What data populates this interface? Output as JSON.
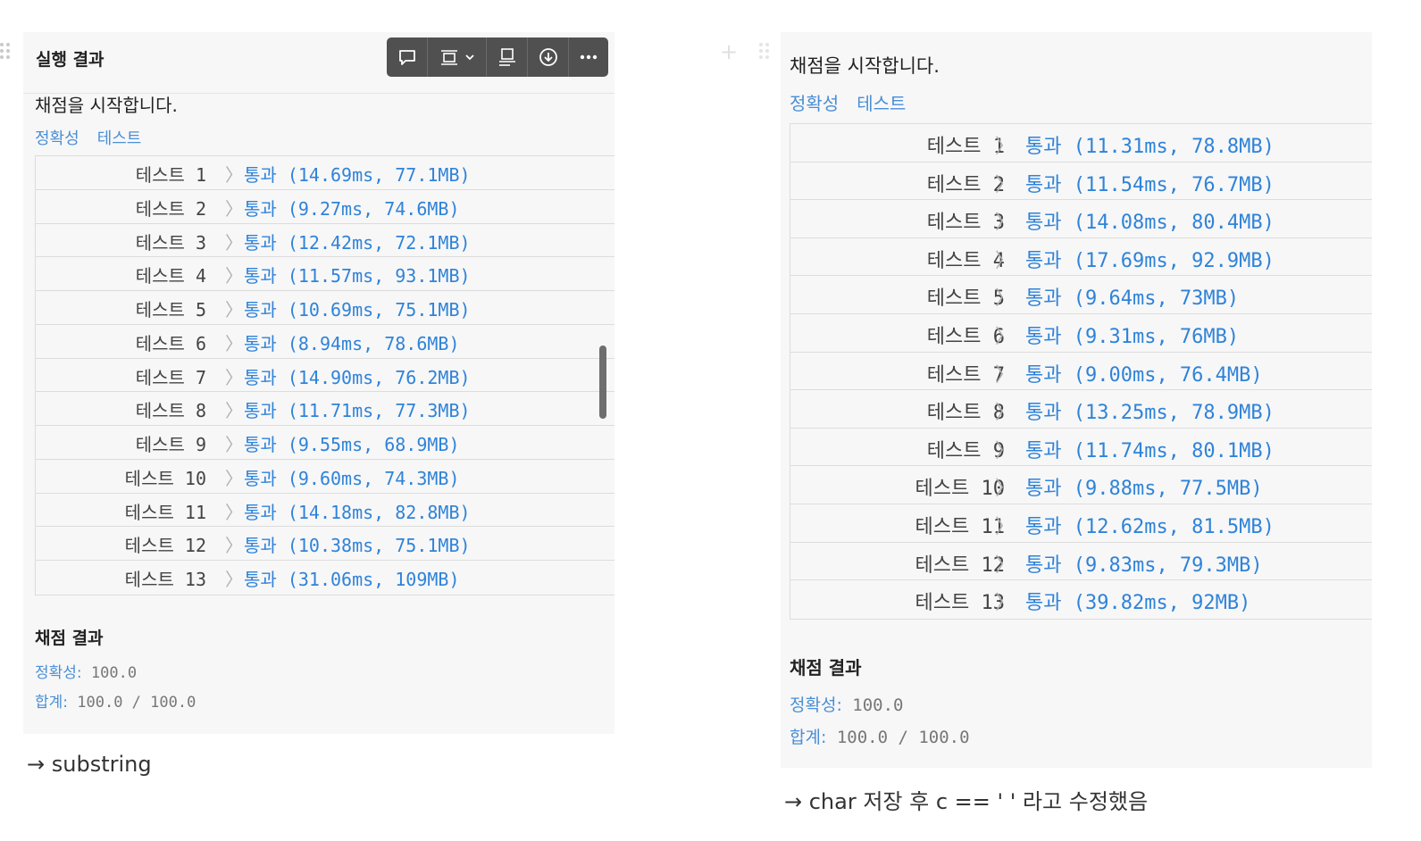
{
  "left": {
    "header_title": "실행 결과",
    "grading_start": "채점을 시작합니다.",
    "tab_accuracy": "정확성",
    "tab_test": "테스트",
    "chevron": "〉",
    "results": [
      {
        "label": "테스트 1",
        "result": "통과 (14.69ms, 77.1MB)"
      },
      {
        "label": "테스트 2",
        "result": "통과 (9.27ms, 74.6MB)"
      },
      {
        "label": "테스트 3",
        "result": "통과 (12.42ms, 72.1MB)"
      },
      {
        "label": "테스트 4",
        "result": "통과 (11.57ms, 93.1MB)"
      },
      {
        "label": "테스트 5",
        "result": "통과 (10.69ms, 75.1MB)"
      },
      {
        "label": "테스트 6",
        "result": "통과 (8.94ms, 78.6MB)"
      },
      {
        "label": "테스트 7",
        "result": "통과 (14.90ms, 76.2MB)"
      },
      {
        "label": "테스트 8",
        "result": "통과 (11.71ms, 77.3MB)"
      },
      {
        "label": "테스트 9",
        "result": "통과 (9.55ms, 68.9MB)"
      },
      {
        "label": "테스트 10",
        "result": "통과 (9.60ms, 74.3MB)"
      },
      {
        "label": "테스트 11",
        "result": "통과 (14.18ms, 82.8MB)"
      },
      {
        "label": "테스트 12",
        "result": "통과 (10.38ms, 75.1MB)"
      },
      {
        "label": "테스트 13",
        "result": "통과 (31.06ms, 109MB)"
      }
    ],
    "summary_title": "채점 결과",
    "accuracy_key": "정확성:",
    "accuracy_value": "100.0",
    "total_key": "합계:",
    "total_value": "100.0 / 100.0",
    "caption": "→ substring"
  },
  "right": {
    "grading_start": "채점을 시작합니다.",
    "tab_accuracy": "정확성",
    "tab_test": "테스트",
    "chevron": "〉",
    "results": [
      {
        "label": "테스트 1",
        "result": "통과 (11.31ms, 78.8MB)"
      },
      {
        "label": "테스트 2",
        "result": "통과 (11.54ms, 76.7MB)"
      },
      {
        "label": "테스트 3",
        "result": "통과 (14.08ms, 80.4MB)"
      },
      {
        "label": "테스트 4",
        "result": "통과 (17.69ms, 92.9MB)"
      },
      {
        "label": "테스트 5",
        "result": "통과 (9.64ms, 73MB)"
      },
      {
        "label": "테스트 6",
        "result": "통과 (9.31ms, 76MB)"
      },
      {
        "label": "테스트 7",
        "result": "통과 (9.00ms, 76.4MB)"
      },
      {
        "label": "테스트 8",
        "result": "통과 (13.25ms, 78.9MB)"
      },
      {
        "label": "테스트 9",
        "result": "통과 (11.74ms, 80.1MB)"
      },
      {
        "label": "테스트 10",
        "result": "통과 (9.88ms, 77.5MB)"
      },
      {
        "label": "테스트 11",
        "result": "통과 (12.62ms, 81.5MB)"
      },
      {
        "label": "테스트 12",
        "result": "통과 (9.83ms, 79.3MB)"
      },
      {
        "label": "테스트 13",
        "result": "통과 (39.82ms, 92MB)"
      }
    ],
    "summary_title": "채점 결과",
    "accuracy_key": "정확성:",
    "accuracy_value": "100.0",
    "total_key": "합계:",
    "total_value": "100.0 / 100.0",
    "caption": "→ char 저장 후 c == ' ' 라고 수정했음"
  },
  "toolbar": {
    "icons": [
      "comment-icon",
      "layout-icon",
      "chevron-down-icon",
      "caption-icon",
      "download-icon",
      "more-icon"
    ]
  },
  "colors": {
    "pass": "#2f83d9",
    "tab": "#4a8fd6",
    "panel_bg": "#f7f7f7",
    "toolbar_bg": "#505050"
  }
}
